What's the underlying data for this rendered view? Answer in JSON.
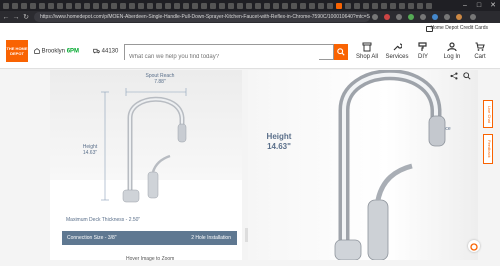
{
  "browser": {
    "url": "https://www.homedepot.com/p/MOEN-Aberdeen-Single-Handle-Pull-Down-Sprayer-Kitchen-Faucet-with-Reflex-in-Chrome-7590C/100010640?mtc=SEM-BF-A..."
  },
  "topbar": {
    "credit_cards": "Home Depot Credit Cards"
  },
  "header": {
    "logo_text": "THE HOME DEPOT",
    "store_name": "Brooklyn",
    "store_status": "6PM",
    "zip": "44130",
    "search_placeholder": "What can we help you find today?",
    "nav": {
      "shop_all": "Shop All",
      "services": "Services",
      "diy": "DIY",
      "log_in": "Log In",
      "cart": "Cart"
    }
  },
  "spec_image": {
    "spout_reach_label": "Spout Reach",
    "spout_reach_value": "7.88\"",
    "height_label": "Height",
    "height_value": "14.63\"",
    "deck_thickness": "Maximum Deck Thickness - 2.50\"",
    "connection_size": "Connection Size - 3/8\"",
    "installation": "2 Hole Installation"
  },
  "main_image": {
    "height_label": "Height",
    "height_value": "14.63\"",
    "partial_text": "ce"
  },
  "side_tabs": {
    "live_chat": "Live Chat",
    "feedback": "Feedback"
  },
  "footer": {
    "hover_hint": "Hover Image to Zoom"
  },
  "colors": {
    "brand": "#f96302",
    "spec_bar": "#5f7891",
    "dim_text": "#5a6f8a"
  }
}
